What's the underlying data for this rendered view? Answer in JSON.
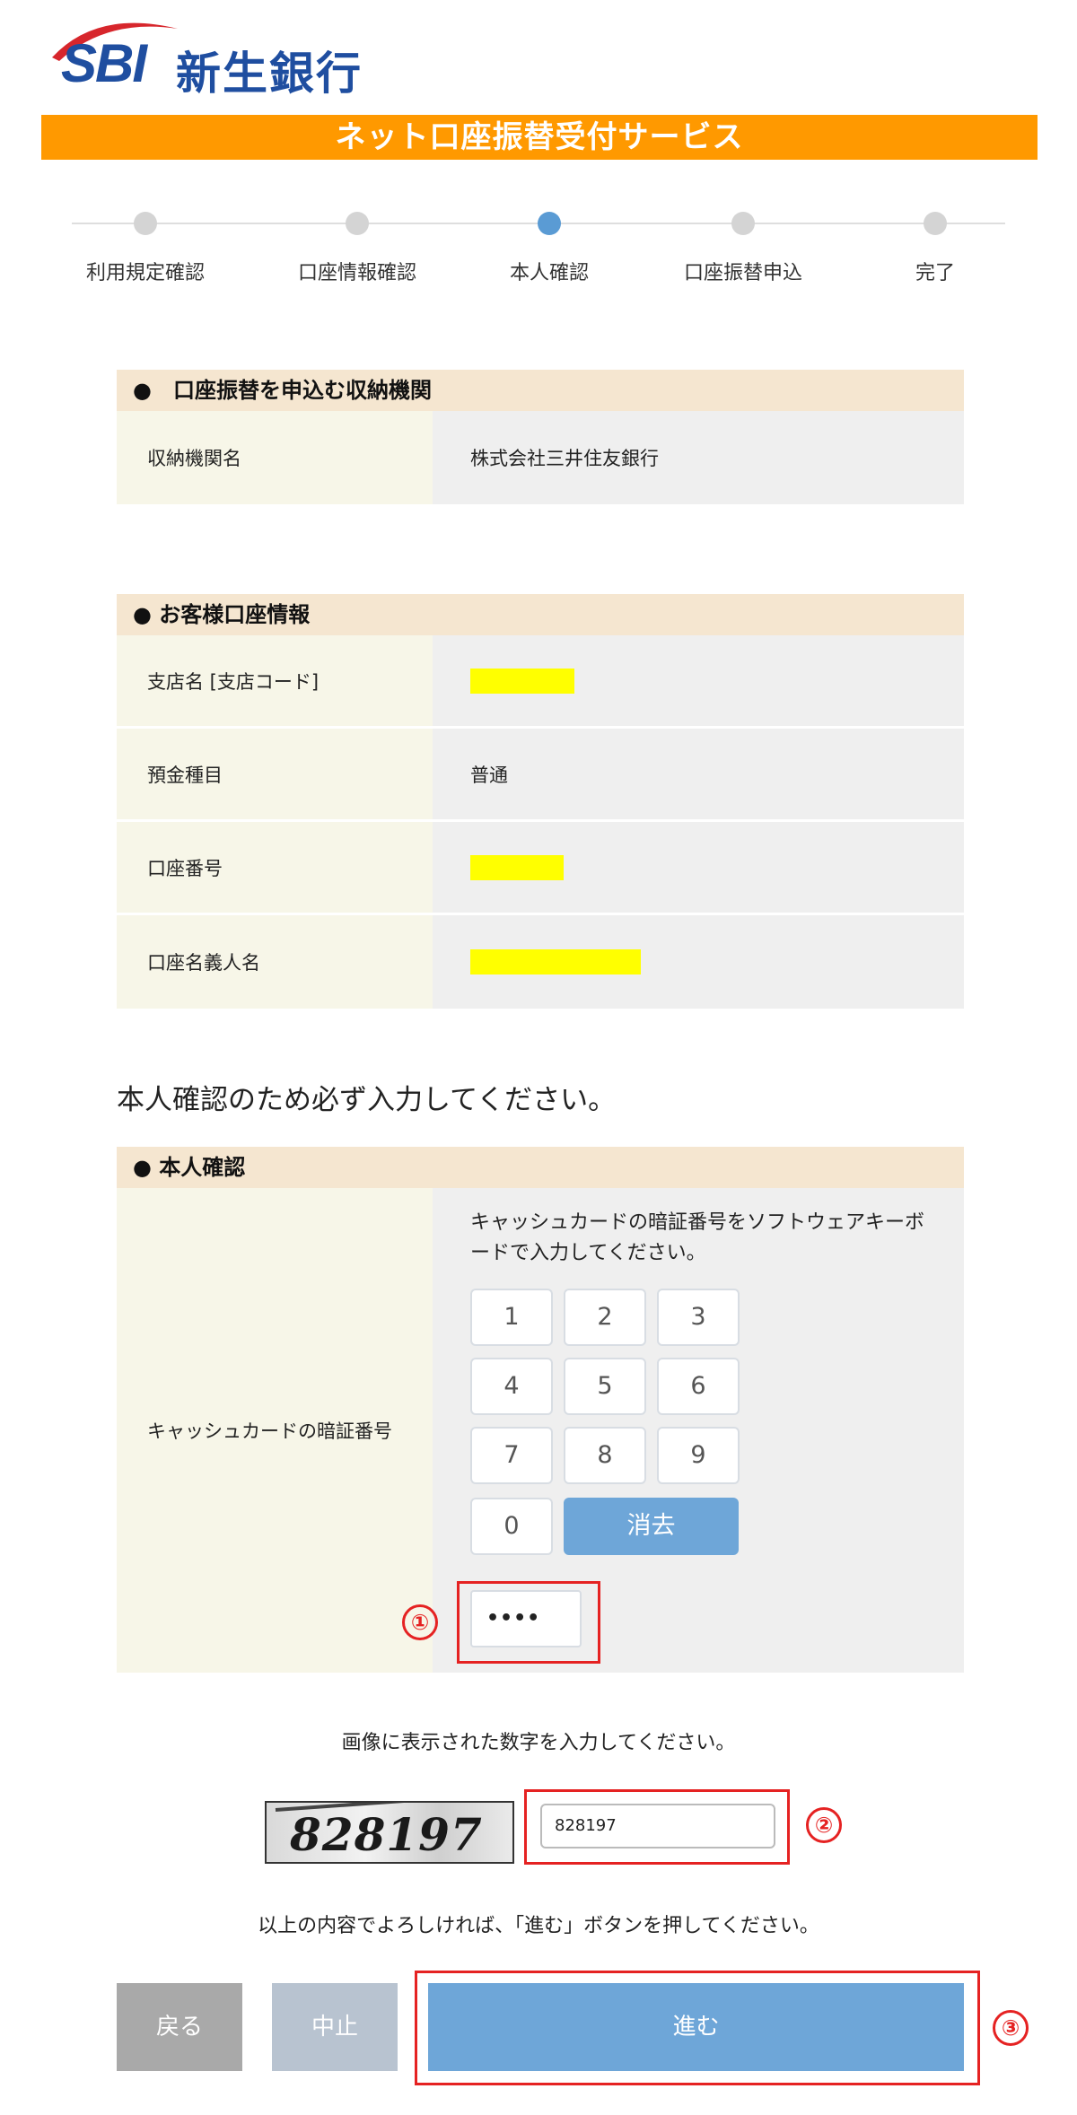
{
  "header": {
    "logo_mark": "SBI",
    "logo_name": "新生銀行",
    "banner_title": "ネット口座振替受付サービス"
  },
  "colors": {
    "brand_blue": "#1f4ea0",
    "banner_orange": "#ff9900",
    "active_step": "#5a9bd4",
    "primary_button": "#6ea6d8",
    "annotation_red": "#e52222"
  },
  "steps": [
    {
      "label": "利用規定確認",
      "active": false
    },
    {
      "label": "口座情報確認",
      "active": false
    },
    {
      "label": "本人確認",
      "active": true
    },
    {
      "label": "口座振替申込",
      "active": false
    },
    {
      "label": "完了",
      "active": false
    }
  ],
  "institution_section": {
    "title": "●　口座振替を申込む収納機関",
    "rows": [
      {
        "label": "収納機関名",
        "value": "株式会社三井住友銀行"
      }
    ]
  },
  "account_section": {
    "title": "●  お客様口座情報",
    "rows": [
      {
        "label": "支店名 [支店コード]",
        "value": "",
        "redacted": true
      },
      {
        "label": "預金種目",
        "value": "普通",
        "redacted": false
      },
      {
        "label": "口座番号",
        "value": "",
        "redacted": true
      },
      {
        "label": "口座名義人名",
        "value": "",
        "redacted": true
      }
    ]
  },
  "identity_notice": "本人確認のため必ず入力してください。",
  "identity_section": {
    "title": "●  本人確認",
    "pin_label": "キャッシュカードの暗証番号",
    "pin_instruction": "キャッシュカードの暗証番号をソフトウェアキーボードで入力してください。",
    "keys": [
      "1",
      "2",
      "3",
      "4",
      "5",
      "6",
      "7",
      "8",
      "9",
      "0"
    ],
    "clear_label": "消去",
    "pin_value": "••••"
  },
  "captcha": {
    "instruction": "画像に表示された数字を入力してください。",
    "image_text": "828197",
    "input_value": "828197"
  },
  "confirm_instruction": "以上の内容でよろしければ、「進む」ボタンを押してください。",
  "buttons": {
    "back": "戻る",
    "stop": "中止",
    "next": "進む"
  },
  "annotations": [
    "①",
    "②",
    "③"
  ]
}
